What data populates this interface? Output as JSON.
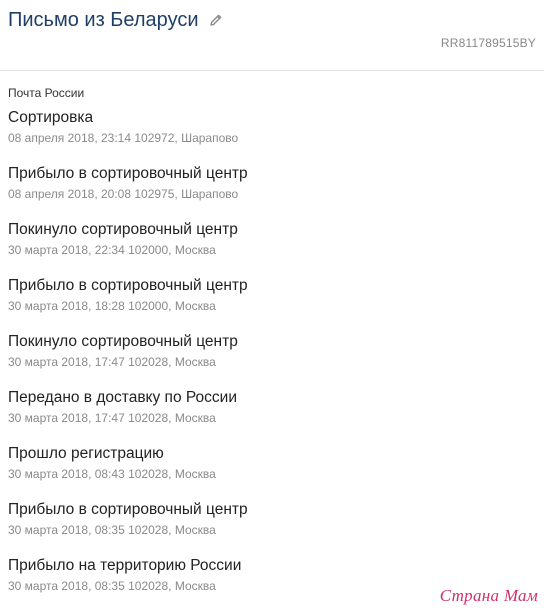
{
  "header": {
    "title": "Письмо из Беларуси",
    "track_number": "RR811789515BY",
    "edit_icon": "pencil-icon"
  },
  "carrier": "Почта России",
  "events": [
    {
      "status": "Сортировка",
      "meta": "08 апреля 2018, 23:14 102972, Шарапово"
    },
    {
      "status": "Прибыло в сортировочный центр",
      "meta": "08 апреля 2018, 20:08 102975, Шарапово"
    },
    {
      "status": "Покинуло сортировочный центр",
      "meta": "30 марта 2018, 22:34 102000, Москва"
    },
    {
      "status": "Прибыло в сортировочный центр",
      "meta": "30 марта 2018, 18:28 102000, Москва"
    },
    {
      "status": "Покинуло сортировочный центр",
      "meta": "30 марта 2018, 17:47 102028, Москва"
    },
    {
      "status": "Передано в доставку по России",
      "meta": "30 марта 2018, 17:47 102028, Москва"
    },
    {
      "status": "Прошло регистрацию",
      "meta": "30 марта 2018, 08:43 102028, Москва"
    },
    {
      "status": "Прибыло в сортировочный центр",
      "meta": "30 марта 2018, 08:35 102028, Москва"
    },
    {
      "status": "Прибыло на территорию России",
      "meta": "30 марта 2018, 08:35 102028, Москва"
    }
  ],
  "watermark": "Страна Мам",
  "colors": {
    "title": "#1f3f66",
    "meta": "#8a8a8a",
    "watermark": "#d0306a"
  }
}
